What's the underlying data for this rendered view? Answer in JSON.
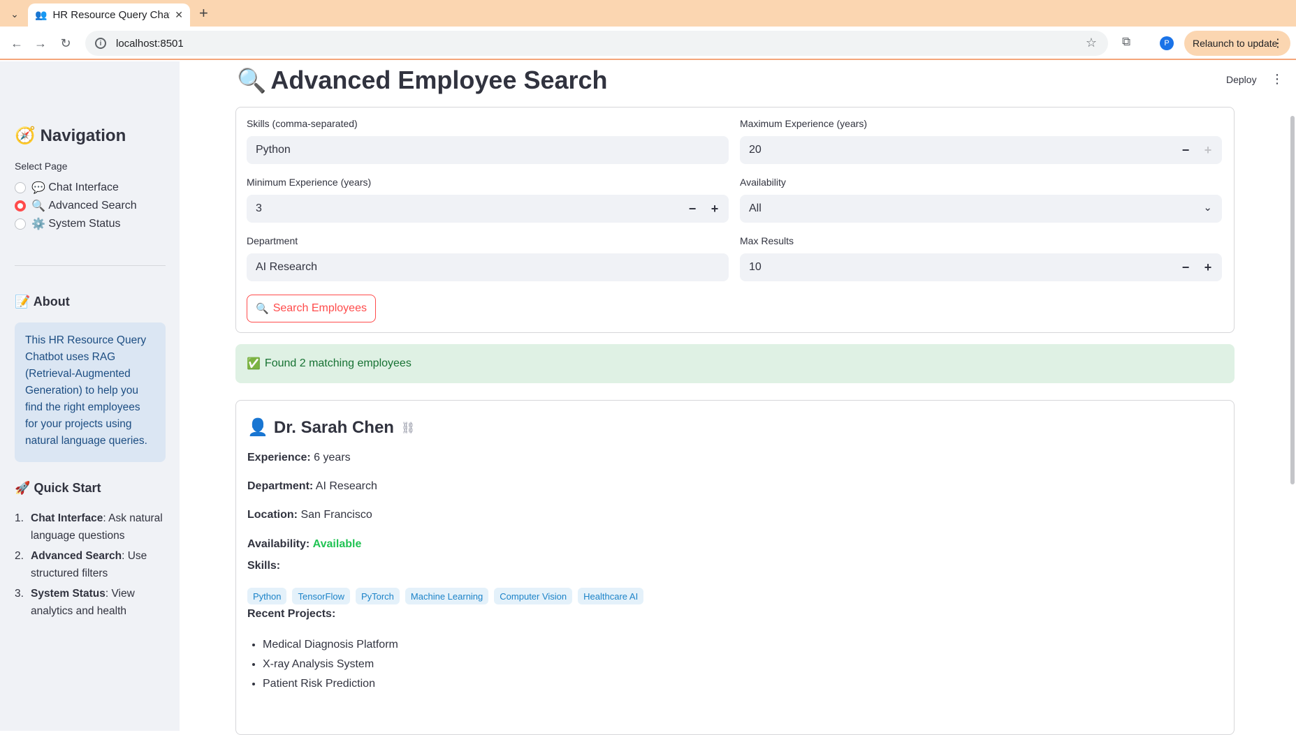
{
  "browser": {
    "tab_title": "HR Resource Query Chat",
    "url": "localhost:8501",
    "relaunch_label": "Relaunch to update",
    "profile_initial": "P"
  },
  "sidebar": {
    "nav_title": "Navigation",
    "select_label": "Select Page",
    "pages": [
      {
        "icon": "💬",
        "label": "Chat Interface",
        "selected": false
      },
      {
        "icon": "🔍",
        "label": "Advanced Search",
        "selected": true
      },
      {
        "icon": "⚙️",
        "label": "System Status",
        "selected": false
      }
    ],
    "about_title": "About",
    "about_text": "This HR Resource Query Chatbot uses RAG (Retrieval-Augmented Generation) to help you find the right employees for your projects using natural language queries.",
    "quick_start_title": "Quick Start",
    "quick_start": [
      {
        "num": "1.",
        "bold": "Chat Interface",
        "rest": ": Ask natural language questions"
      },
      {
        "num": "2.",
        "bold": "Advanced Search",
        "rest": ": Use structured filters"
      },
      {
        "num": "3.",
        "bold": "System Status",
        "rest": ": View analytics and health"
      }
    ]
  },
  "header": {
    "title": "Advanced Employee Search",
    "deploy_label": "Deploy"
  },
  "form": {
    "skills_label": "Skills (comma-separated)",
    "skills_value": "Python",
    "max_exp_label": "Maximum Experience (years)",
    "max_exp_value": "20",
    "min_exp_label": "Minimum Experience (years)",
    "min_exp_value": "3",
    "availability_label": "Availability",
    "availability_value": "All",
    "department_label": "Department",
    "department_value": "AI Research",
    "max_results_label": "Max Results",
    "max_results_value": "10",
    "search_button": "Search Employees",
    "minus": "−",
    "plus": "+"
  },
  "result_message": "Found 2 matching employees",
  "employee": {
    "name": "Dr. Sarah Chen",
    "experience_label": "Experience:",
    "experience_value": "6 years",
    "department_label": "Department:",
    "department_value": "AI Research",
    "location_label": "Location:",
    "location_value": "San Francisco",
    "availability_label": "Availability:",
    "availability_value": "Available",
    "skills_label": "Skills:",
    "skills": [
      "Python",
      "TensorFlow",
      "PyTorch",
      "Machine Learning",
      "Computer Vision",
      "Healthcare AI"
    ],
    "projects_label": "Recent Projects:",
    "projects": [
      "Medical Diagnosis Platform",
      "X-ray Analysis System",
      "Patient Risk Prediction"
    ]
  }
}
